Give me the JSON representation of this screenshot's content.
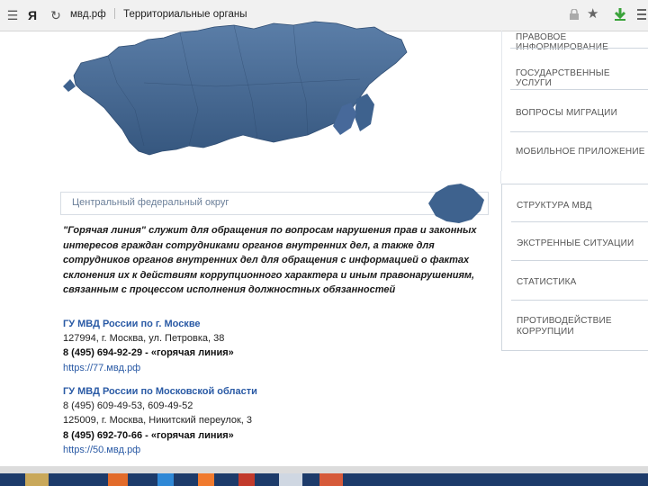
{
  "browser": {
    "yandex_glyph": "Я",
    "host": "мвд.рф",
    "page_title": "Территориальные органы"
  },
  "colors": {
    "map_fill": "#3e628e",
    "accent_link": "#2a5aa5",
    "menu_text": "#555555"
  },
  "right_menu": {
    "top_items": [
      "ПРАВОВОЕ ИНФОРМИРОВАНИЕ",
      "ГОСУДАРСТВЕННЫЕ УСЛУГИ",
      "ВОПРОСЫ МИГРАЦИИ",
      "МОБИЛЬНОЕ ПРИЛОЖЕНИЕ"
    ],
    "box_items": [
      "СТРУКТУРА МВД",
      "ЭКСТРЕННЫЕ СИТУАЦИИ",
      "СТАТИСТИКА",
      "ПРОТИВОДЕЙСТВИЕ",
      "КОРРУПЦИИ"
    ]
  },
  "district": {
    "label": "Центральный федеральный округ"
  },
  "intro": "\"Горячая линия\" служит для обращения по вопросам нарушения прав и законных интересов граждан сотрудниками органов внутренних дел, а также для сотрудников органов внутренних дел для обращения с информацией о фактах склонения их к действиям коррупционного характера и иным правонарушениям, связанным с процессом исполнения должностных обязанностей",
  "orgs": [
    {
      "title": "ГУ МВД России по г. Москве",
      "address": "127994, г. Москва, ул. Петровка, 38",
      "phone": "8 (495) 694-92-29 - «горячая линия»",
      "site": "https://77.мвд.рф"
    },
    {
      "title": "ГУ МВД России по Московской области",
      "phone_extra": "8 (495) 609-49-53, 609-49-52",
      "address": "125009, г. Москва, Никитский переулок, 3",
      "phone": "8 (495) 692-70-66 - «горячая линия»",
      "site": "https://50.мвд.рф"
    }
  ]
}
